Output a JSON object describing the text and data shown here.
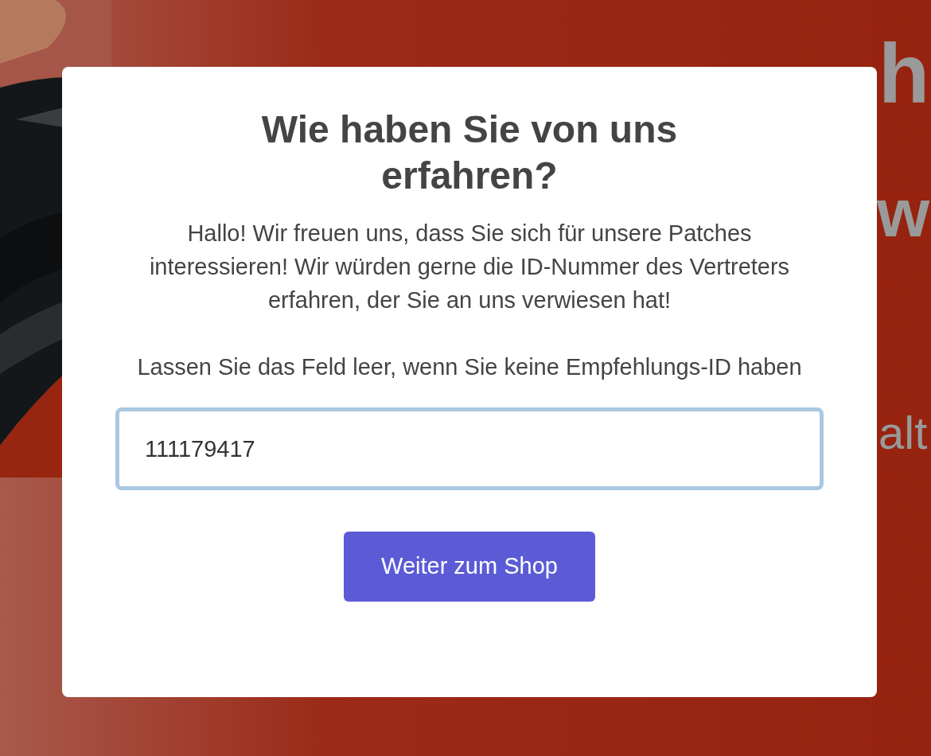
{
  "background": {
    "headline_fragments": [
      "h",
      "w"
    ],
    "subline_fragment": "alt"
  },
  "modal": {
    "title": "Wie haben Sie von uns erfahren?",
    "paragraphs": [
      "Hallo! Wir freuen uns, dass Sie sich für unsere Patches interessieren! Wir würden gerne die ID-Nummer des Vertreters erfahren, der Sie an uns verwiesen hat!",
      "Lassen Sie das Feld leer, wenn Sie keine Empfehlungs-ID haben"
    ],
    "input": {
      "value": "111179417",
      "focused": true
    },
    "button": "Weiter zum Shop"
  }
}
